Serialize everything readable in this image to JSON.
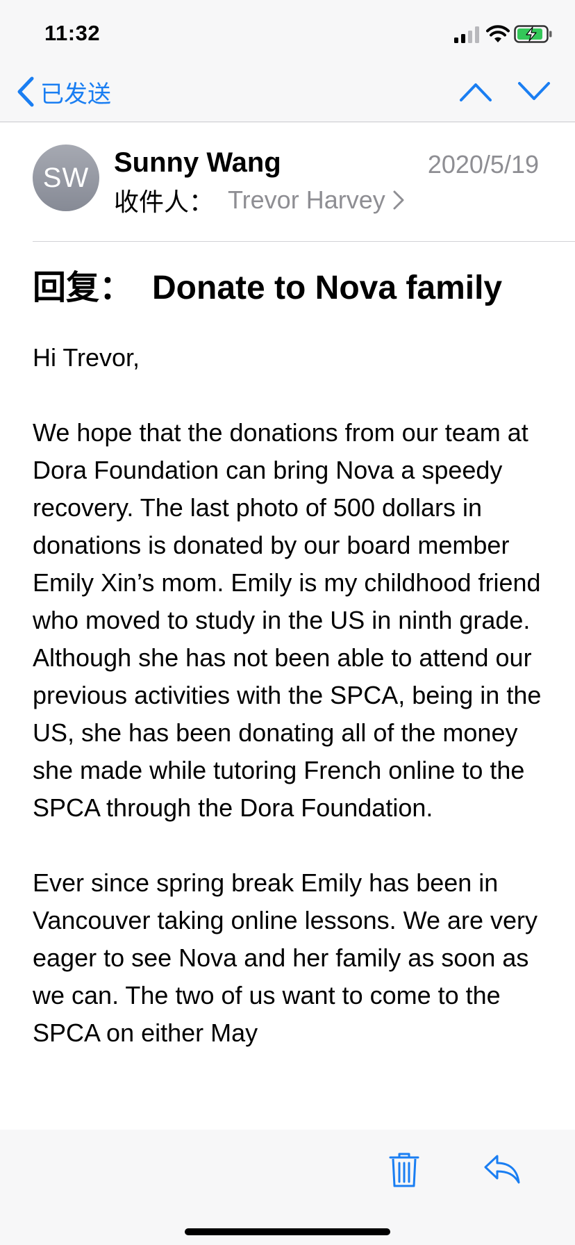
{
  "status_bar": {
    "time": "11:32",
    "icons": [
      "cellular-signal-icon",
      "wifi-icon",
      "battery-charging-icon"
    ]
  },
  "nav": {
    "back_label": "已发送",
    "icons": [
      "chevron-left-icon",
      "chevron-up-icon",
      "chevron-down-icon"
    ]
  },
  "header": {
    "avatar_initials": "SW",
    "sender": "Sunny Wang",
    "date": "2020/5/19",
    "to_label": "收件人：",
    "to_name": "Trevor Harvey"
  },
  "subject": {
    "prefix": "回复：",
    "text": "Donate to Nova family"
  },
  "body": {
    "greeting": "Hi Trevor,",
    "paragraph_1": "We hope that the donations from our team at Dora Foundation can bring Nova a speedy recovery. The last photo of 500 dollars in donations is donated by our board member Emily Xin’s mom. Emily is my childhood friend who moved to study in the US in ninth grade. Although she has not been able to attend our previous activities with the SPCA, being in the US, she has been donating all of the money she made while tutoring French online to the SPCA through the Dora Foundation.",
    "paragraph_2": "Ever since spring break Emily has been in Vancouver taking online lessons. We are very eager to see Nova and her family as soon as we can. The two of us want to come to the SPCA on either May"
  },
  "toolbar": {
    "icons": [
      "trash-icon",
      "reply-icon"
    ]
  },
  "colors": {
    "accent": "#1a7ef2",
    "secondary_text": "#8e8e93",
    "bar_background": "#f7f7f8"
  }
}
